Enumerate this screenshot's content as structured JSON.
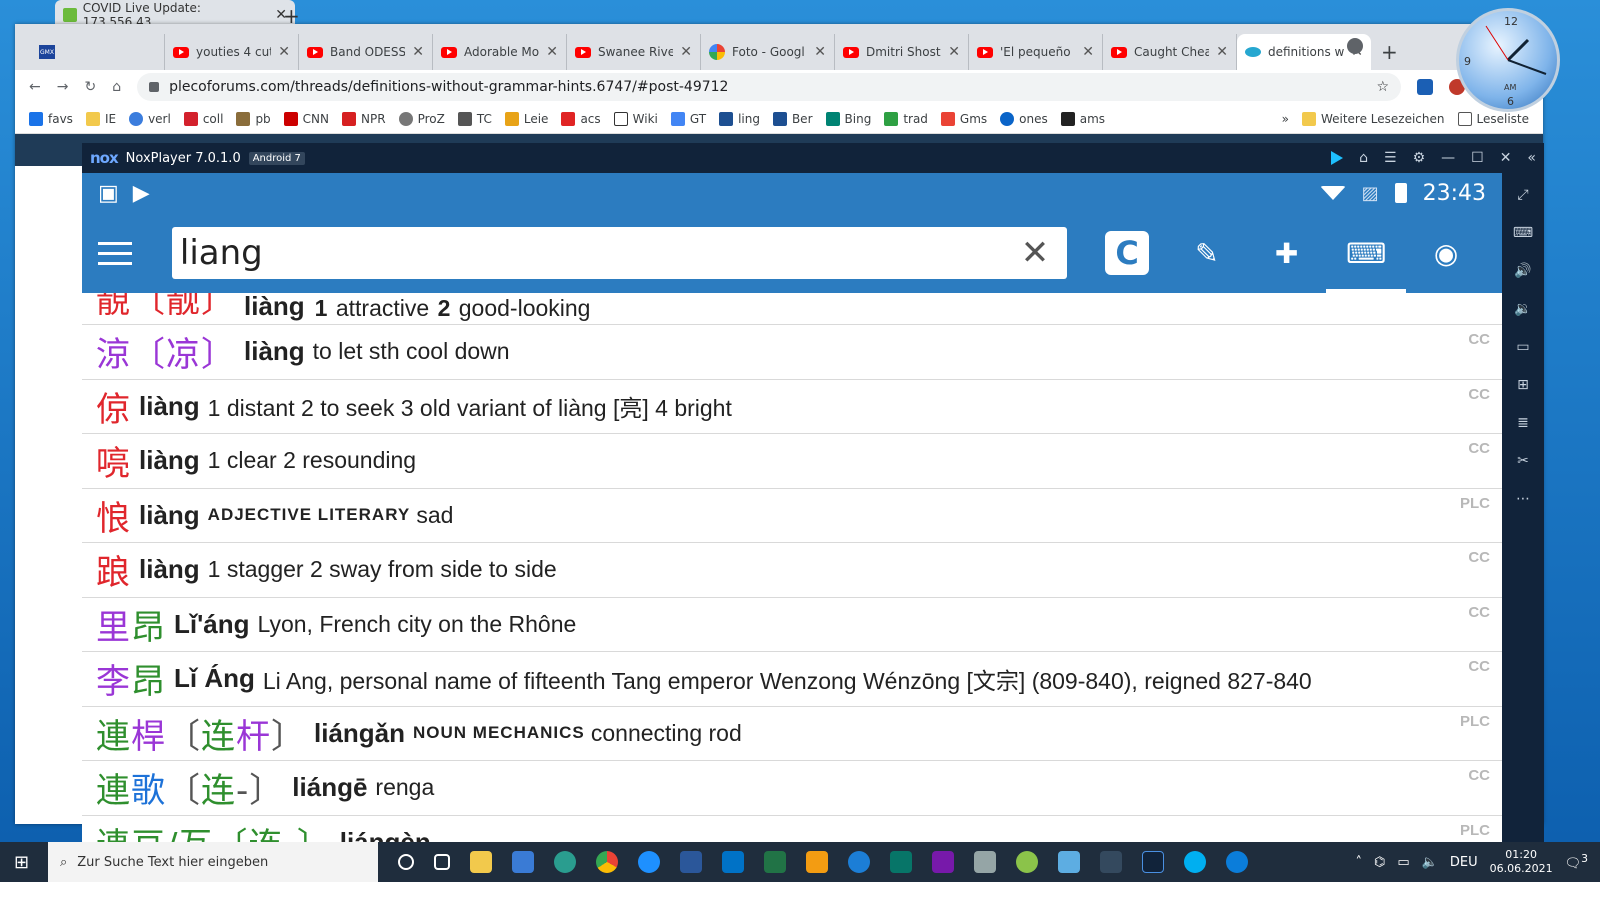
{
  "top_window": {
    "title": "COVID Live Update: 173,556,43"
  },
  "tabs": [
    {
      "label": "youties 4 cute",
      "icon": "youtube-icon"
    },
    {
      "label": "Band ODESSA",
      "icon": "youtube-icon"
    },
    {
      "label": "Adorable Mo",
      "icon": "youtube-icon"
    },
    {
      "label": "Swanee River",
      "icon": "youtube-icon"
    },
    {
      "label": "Foto - Googl",
      "icon": "google-photos-icon"
    },
    {
      "label": "Dmitri Shosta",
      "icon": "youtube-icon"
    },
    {
      "label": "'El pequeño c",
      "icon": "youtube-icon"
    },
    {
      "label": "Caught Chea",
      "icon": "youtube-icon"
    },
    {
      "label": "definitions w",
      "icon": "pleco-icon"
    }
  ],
  "address": {
    "url": "plecoforums.com/threads/definitions-without-grammar-hints.6747/#post-49712"
  },
  "bookmarks": [
    "favs",
    "IE",
    "verl",
    "coll",
    "pb",
    "CNN",
    "NPR",
    "ProZ",
    "TC",
    "Leie",
    "acs",
    "Wiki",
    "GT",
    "ling",
    "Ber",
    "Bing",
    "trad",
    "Gms",
    "ones",
    "ams"
  ],
  "bookmarks_more": "»",
  "bookmarks_other": "Weitere Lesezeichen",
  "reading_list": "Leseliste",
  "nox": {
    "app": "NoxPlayer 7.0.1.0",
    "android": "Android 7",
    "logo": "nox"
  },
  "status_time": "23:43",
  "search": {
    "value": "liang"
  },
  "app_buttons": {
    "c": "C"
  },
  "entries": [
    {
      "hz": "靚〔靓〕",
      "py": "liàng",
      "parts": [
        "1",
        "attractive",
        "2",
        "good-looking"
      ],
      "src": ""
    },
    {
      "hz": "涼〔凉〕",
      "py": "liàng",
      "def": "to let sth cool down",
      "src": "CC"
    },
    {
      "hz": "倞",
      "py": "liàng",
      "def": "1 distant  2 to seek  3 old variant of liàng [亮]  4 bright",
      "src": "CC"
    },
    {
      "hz": "喨",
      "py": "liàng",
      "def": "1 clear  2 resounding",
      "src": "CC"
    },
    {
      "hz": "悢",
      "py": "liàng",
      "tag": "adjective literary",
      "def": "sad",
      "src": "PLC"
    },
    {
      "hz": "踉",
      "py": "liàng",
      "def": "1 stagger  2 sway from side to side",
      "src": "CC"
    },
    {
      "hz": "里昂",
      "py": "Lǐ'áng",
      "def": "Lyon, French city on the Rhône",
      "src": "CC"
    },
    {
      "hz": "李昂",
      "py": "Lǐ Áng",
      "def": "Li Ang, personal name of fifteenth Tang emperor Wenzong Wénzōng [文宗] (809-840), reigned 827-840",
      "src": "CC"
    },
    {
      "hz": "連桿〔连杆〕",
      "py": "liángǎn",
      "tag": "noun mechanics",
      "def": "connecting rod",
      "src": "PLC"
    },
    {
      "hz": "連歌〔连-〕",
      "py": "liángē",
      "def": "renga",
      "src": "CC"
    },
    {
      "hz": "連亘/互〔连-〕",
      "py": "liángèn",
      "def": "",
      "src": "PLC"
    }
  ],
  "taskbar": {
    "search_placeholder": "Zur Suche Text hier eingeben",
    "lang": "DEU",
    "time": "01:20",
    "date": "06.06.2021",
    "notif": "3"
  },
  "gadget_clock": {
    "n12": "12",
    "n9": "9",
    "n6": "6",
    "ampm": "AM"
  },
  "colors": {
    "pleco_blue": "#2c7cc0",
    "nox_dark": "#11233a"
  }
}
